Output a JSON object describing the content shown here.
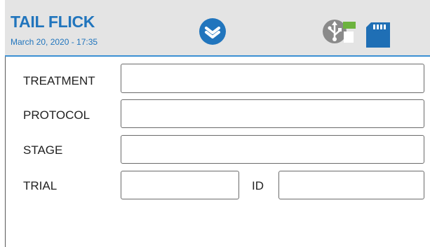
{
  "header": {
    "title": "TAIL FLICK",
    "datetime": "March 20, 2020 - 17:35",
    "menu_icon": "layers-chevron-icon",
    "usb_icon": "usb-icon",
    "sd_icon": "sd-card-icon",
    "accent_color": "#2175bd",
    "usb_status_color": "#6cb33e"
  },
  "form": {
    "treatment_label": "TREATMENT",
    "treatment_value": "",
    "protocol_label": "PROTOCOL",
    "protocol_value": "",
    "stage_label": "STAGE",
    "stage_value": "",
    "trial_label": "TRIAL",
    "trial_value": "",
    "id_label": "ID",
    "id_value": ""
  }
}
